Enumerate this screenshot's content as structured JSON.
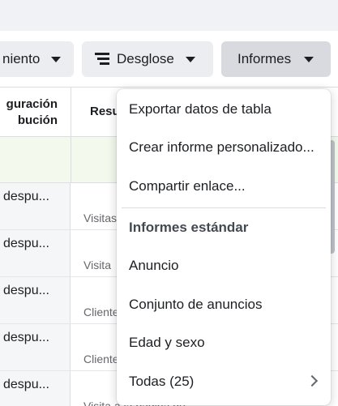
{
  "toolbar": {
    "rendimiento_label": "niento",
    "desglose_label": "Desglose",
    "informes_label": "Informes"
  },
  "table": {
    "header_col1": "guración\nbución",
    "header_col2": "Resu",
    "rows": [
      {
        "name": "despu...",
        "sub": "Visitas"
      },
      {
        "name": "despu...",
        "sub": "Visita"
      },
      {
        "name": "despu...",
        "sub": "Cliente"
      },
      {
        "name": "despu...",
        "sub": "Cliente"
      },
      {
        "name": "despu...",
        "sub": "Visita a la página de"
      }
    ]
  },
  "menu": {
    "export": "Exportar datos de tabla",
    "custom_report": "Crear informe personalizado...",
    "share_link": "Compartir enlace...",
    "section_title": "Informes estándar",
    "ad": "Anuncio",
    "ad_set": "Conjunto de anuncios",
    "age_gender": "Edad y sexo",
    "all": "Todas (25)"
  }
}
